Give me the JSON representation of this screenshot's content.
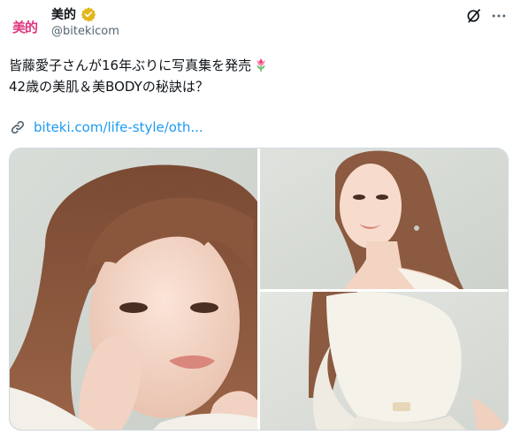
{
  "account": {
    "avatar_text": "美的",
    "display_name": "美的",
    "handle": "@bitekicom",
    "verified_badge_color": "#e2b719",
    "avatar_color": "#e0357f"
  },
  "tweet": {
    "line1": "皆藤愛子さんが16年ぶりに写真集を発売",
    "line2": "42歳の美肌＆美BODYの秘訣は？",
    "emoji_icon": "tulip-emoji"
  },
  "link": {
    "text": "biteki.com/life-style/oth...",
    "icon": "link-icon",
    "color": "#1d9bf0"
  },
  "media": {
    "photos": [
      {
        "name": "portrait-closeup-photo"
      },
      {
        "name": "portrait-profile-photo"
      },
      {
        "name": "full-body-sweater-photo"
      }
    ]
  },
  "toolbar": {
    "grok_icon": "grok-icon",
    "more_icon": "more-icon"
  }
}
